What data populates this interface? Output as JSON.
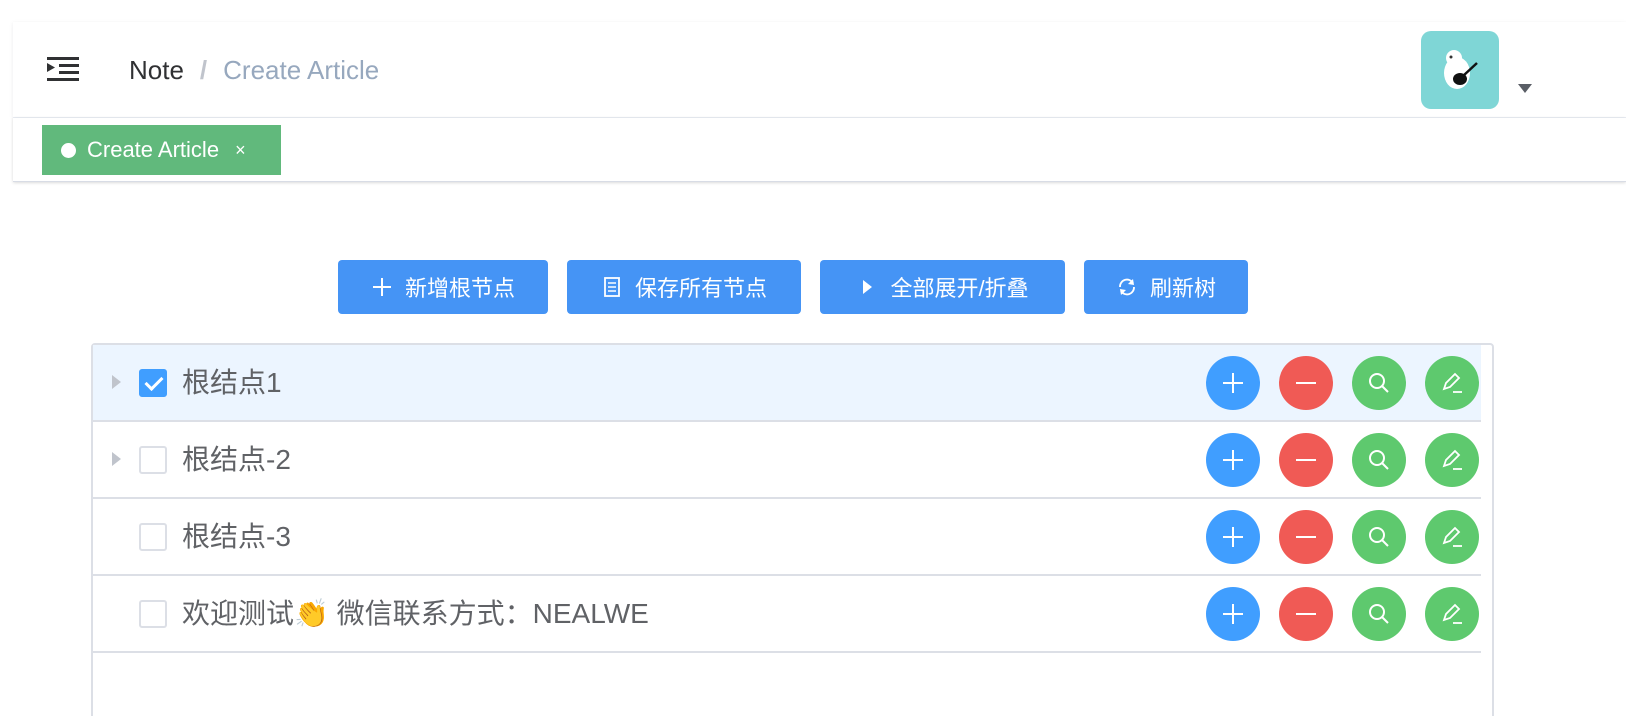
{
  "navbar": {
    "breadcrumb": [
      "Note",
      "Create Article"
    ],
    "separator": "/"
  },
  "tags": [
    {
      "label": "Create Article",
      "close": "×",
      "active": true
    }
  ],
  "toolbar": {
    "add_root": "新增根节点",
    "save_all": "保存所有节点",
    "expand_collapse": "全部展开/折叠",
    "refresh": "刷新树"
  },
  "tree": {
    "nodes": [
      {
        "label": "根结点1",
        "checked": true,
        "has_children": true
      },
      {
        "label": "根结点-2",
        "checked": false,
        "has_children": true
      },
      {
        "label": "根结点-3",
        "checked": false,
        "has_children": false
      },
      {
        "label": "欢迎测试👏 微信联系方式：NEALWE",
        "checked": false,
        "has_children": false
      }
    ]
  },
  "colors": {
    "primary": "#409eff",
    "danger": "#f05a55",
    "success": "#5ec96e",
    "tag": "#61b97c",
    "avatar_bg": "#7fd6d6"
  }
}
